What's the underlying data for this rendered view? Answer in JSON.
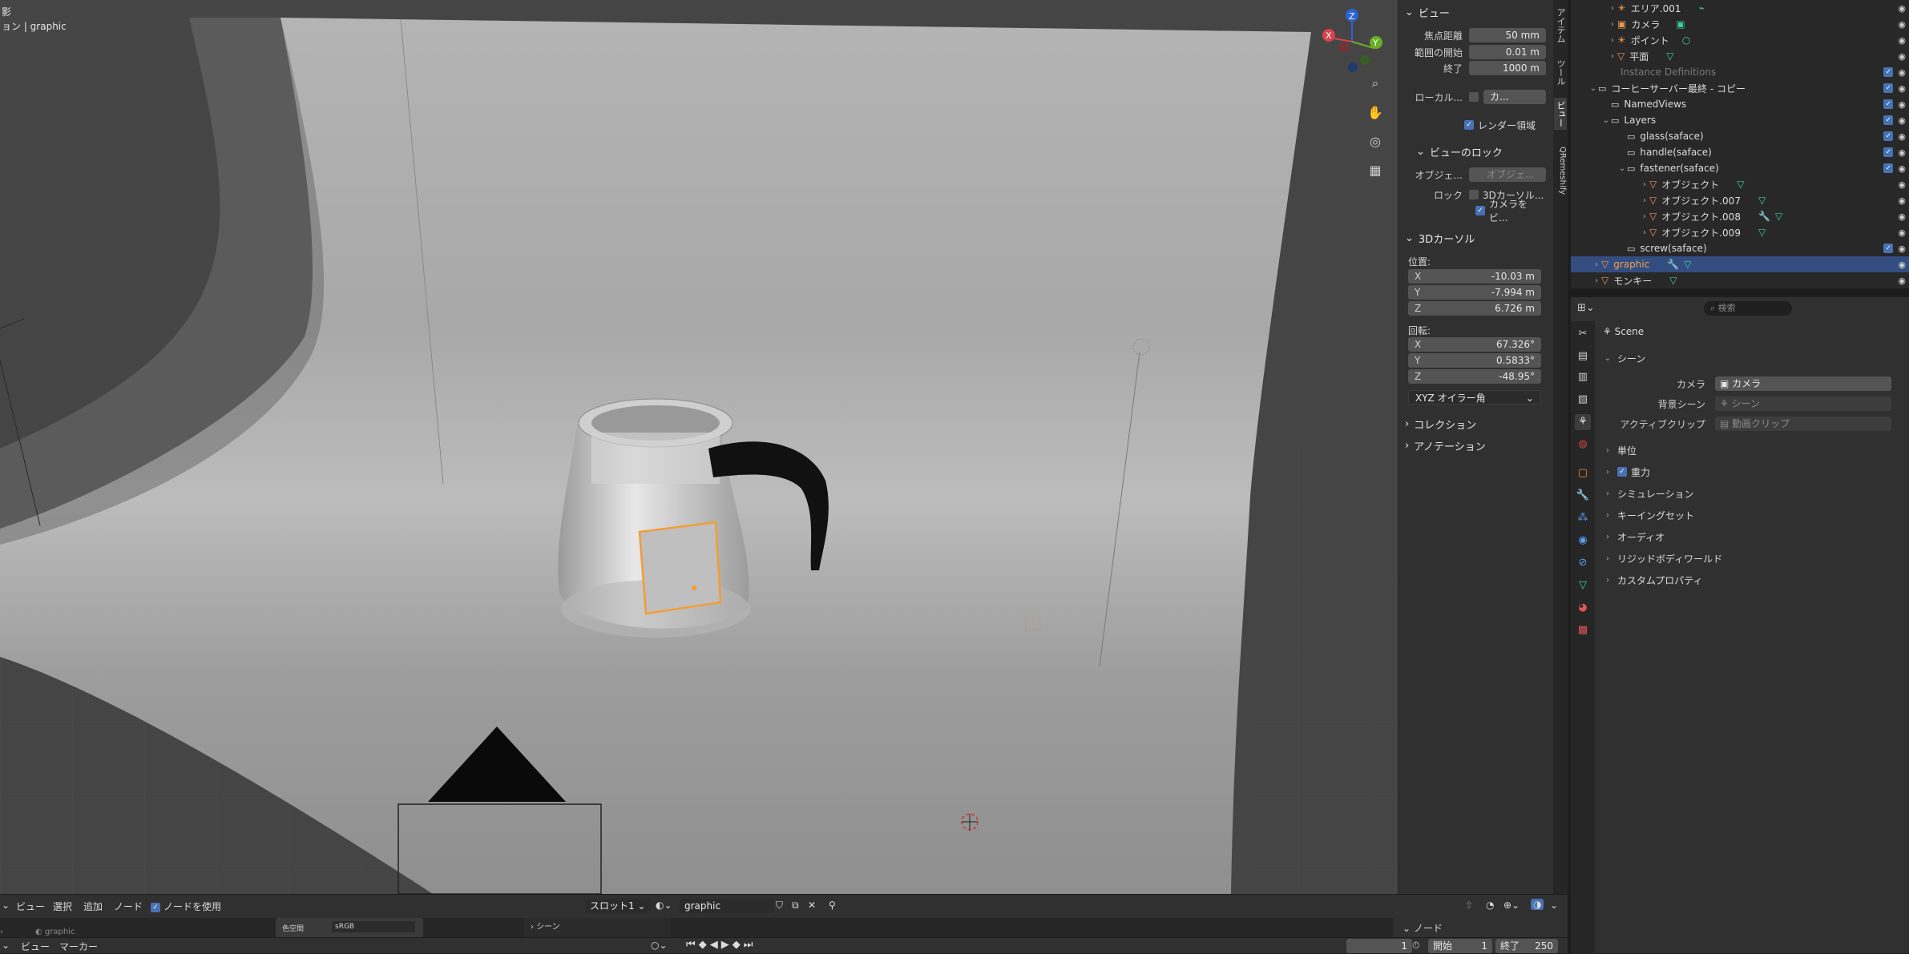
{
  "viewport": {
    "label_top": "影",
    "label_sub": "ョン | graphic",
    "gizmo": {
      "z": "Z",
      "y": "Y",
      "x": "X"
    }
  },
  "npanel": {
    "view_header": "ビュー",
    "focal_label": "焦点距離",
    "focal_value": "50 mm",
    "clip_start_label": "範囲の開始",
    "clip_start_value": "0.01 m",
    "clip_end_label": "終了",
    "clip_end_value": "1000 m",
    "local_label": "ローカル...",
    "local_value": "カ...",
    "render_region": "レンダー領域",
    "view_lock_header": "ビューのロック",
    "object_label": "オブジェ...",
    "object_value": "オブジェ...",
    "lock_label": "ロック",
    "lock_cursor": "3Dカーソル...",
    "lock_camera": "カメラをビ...",
    "cursor_header": "3Dカーソル",
    "location_label": "位置:",
    "loc_x_key": "X",
    "loc_x": "-10.03 m",
    "loc_y_key": "Y",
    "loc_y": "-7.994 m",
    "loc_z_key": "Z",
    "loc_z": "6.726 m",
    "rotation_label": "回転:",
    "rot_x_key": "X",
    "rot_x": "67.326°",
    "rot_y_key": "Y",
    "rot_y": "0.5833°",
    "rot_z_key": "Z",
    "rot_z": "-48.95°",
    "rot_mode": "XYZ オイラー角",
    "collection_header": "コレクション",
    "annotation_header": "アノテーション"
  },
  "sidetabs": [
    "アイテム",
    "ツール",
    "ビュー",
    "QRemeshify"
  ],
  "outliner": {
    "rows": [
      {
        "label": "エリア.001"
      },
      {
        "label": "カメラ"
      },
      {
        "label": "ポイント"
      },
      {
        "label": "平面"
      },
      {
        "label": "Instance Definitions"
      },
      {
        "label": "コーヒーサーバー最終 - コピー"
      },
      {
        "label": "NamedViews"
      },
      {
        "label": "Layers"
      },
      {
        "label": "glass(saface)"
      },
      {
        "label": "handle(saface)"
      },
      {
        "label": "fastener(saface)"
      },
      {
        "label": "オブジェクト"
      },
      {
        "label": "オブジェクト.007"
      },
      {
        "label": "オブジェクト.008"
      },
      {
        "label": "オブジェクト.009"
      },
      {
        "label": "screw(saface)"
      },
      {
        "label": "graphic"
      },
      {
        "label": "モンキー"
      }
    ]
  },
  "properties": {
    "search_placeholder": "検索",
    "scene_name": "Scene",
    "scene_header": "シーン",
    "camera_label": "カメラ",
    "camera_value": "カメラ",
    "bg_scene_label": "背景シーン",
    "bg_scene_value": "シーン",
    "active_clip_label": "アクティブクリップ",
    "active_clip_value": "動画クリップ",
    "panels": [
      "単位",
      "重力",
      "シミュレーション",
      "キーイングセット",
      "オーディオ",
      "リジッドボディワールド",
      "カスタムプロパティ"
    ]
  },
  "bottom": {
    "menu_view": "ビュー",
    "menu_select": "選択",
    "menu_add": "追加",
    "menu_node": "ノード",
    "use_nodes": "ノードを使用",
    "slot": "スロット1",
    "image_name": "graphic",
    "node_label": "ノード",
    "colorspace_label": "色空間",
    "colorspace_value": "sRGB",
    "scene_item": "シーン",
    "timeline_view": "ビュー",
    "timeline_marker": "マーカー",
    "graphic_crumb": "graphic",
    "frame_current": "1",
    "start_label": "開始",
    "start_value": "1",
    "end_label": "終了",
    "end_value": "250"
  }
}
